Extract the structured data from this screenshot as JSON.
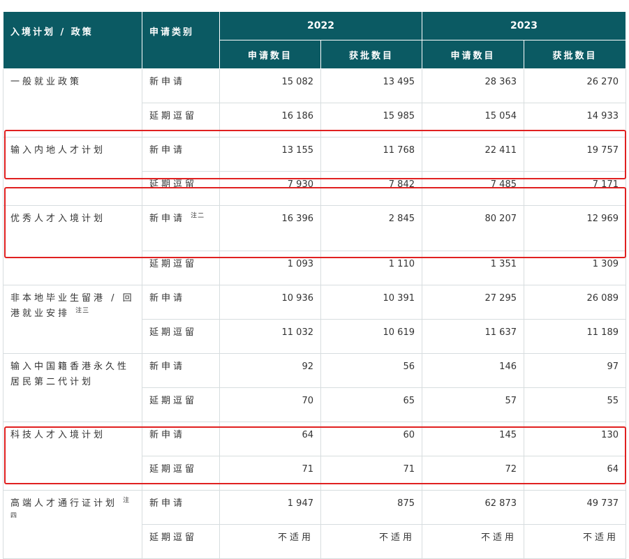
{
  "headers": {
    "scheme": "入境计划 / 政策",
    "category": "申请类别",
    "years": [
      "2022",
      "2023"
    ],
    "applications": "申请数目",
    "approved": "获批数目"
  },
  "rows": [
    {
      "scheme": "一般就业政策",
      "scheme_note": "",
      "new": {
        "cat": "新申请",
        "cat_note": "",
        "v": [
          "15 082",
          "13 495",
          "28 363",
          "26 270"
        ]
      },
      "ext": {
        "cat": "延期逗留",
        "v": [
          "16 186",
          "15 985",
          "15 054",
          "14 933"
        ]
      }
    },
    {
      "scheme": "输入内地人才计划",
      "scheme_note": "",
      "new": {
        "cat": "新申请",
        "cat_note": "",
        "v": [
          "13 155",
          "11 768",
          "22 411",
          "19 757"
        ]
      },
      "ext": {
        "cat": "延期逗留",
        "v": [
          "7 930",
          "7 842",
          "7 485",
          "7 171"
        ]
      }
    },
    {
      "scheme": "优秀人才入境计划",
      "scheme_note": "",
      "new": {
        "cat": "新申请",
        "cat_note": "注二",
        "v": [
          "16 396",
          "2 845",
          "80 207",
          "12 969"
        ]
      },
      "ext": {
        "cat": "延期逗留",
        "v": [
          "1 093",
          "1 110",
          "1 351",
          "1 309"
        ]
      }
    },
    {
      "scheme": "非本地毕业生留港 / 回港就业安排",
      "scheme_note": "注三",
      "new": {
        "cat": "新申请",
        "cat_note": "",
        "v": [
          "10 936",
          "10 391",
          "27 295",
          "26 089"
        ]
      },
      "ext": {
        "cat": "延期逗留",
        "v": [
          "11 032",
          "10 619",
          "11 637",
          "11 189"
        ]
      }
    },
    {
      "scheme": "输入中国籍香港永久性居民第二代计划",
      "scheme_note": "",
      "new": {
        "cat": "新申请",
        "cat_note": "",
        "v": [
          "92",
          "56",
          "146",
          "97"
        ]
      },
      "ext": {
        "cat": "延期逗留",
        "v": [
          "70",
          "65",
          "57",
          "55"
        ]
      }
    },
    {
      "scheme": "科技人才入境计划",
      "scheme_note": "",
      "new": {
        "cat": "新申请",
        "cat_note": "",
        "v": [
          "64",
          "60",
          "145",
          "130"
        ]
      },
      "ext": {
        "cat": "延期逗留",
        "v": [
          "71",
          "71",
          "72",
          "64"
        ]
      }
    },
    {
      "scheme": "高端人才通行证计划",
      "scheme_note": "注四",
      "new": {
        "cat": "新申请",
        "cat_note": "",
        "v": [
          "1 947",
          "875",
          "62 873",
          "49 737"
        ]
      },
      "ext": {
        "cat": "延期逗留",
        "v": [
          "不适用",
          "不适用",
          "不适用",
          "不适用"
        ]
      }
    }
  ],
  "highlight_color": "#e02020",
  "header_color": "#0b5a63"
}
